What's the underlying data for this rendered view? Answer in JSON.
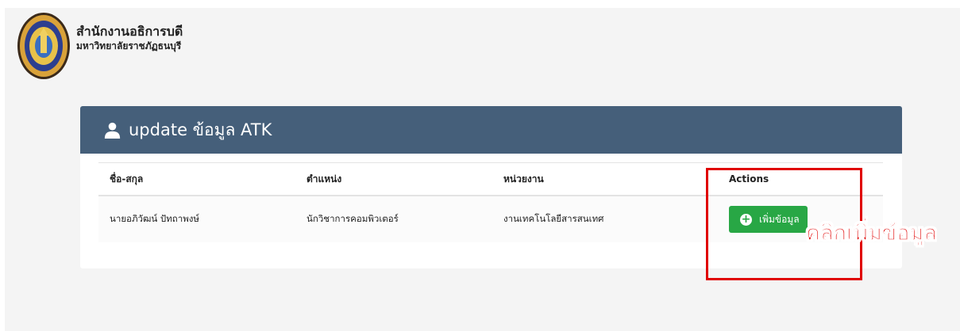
{
  "brand": {
    "title": "สำนักงานอธิการบดี",
    "subtitle": "มหาวิทยาลัยราชภัฏธนบุรี",
    "logo_icon": "university-seal-icon"
  },
  "card": {
    "title": "update ข้อมูล ATK",
    "header_icon": "user-icon",
    "header_color": "#455f7a"
  },
  "table": {
    "columns": [
      "ชื่อ-สกุล",
      "ตำแหน่ง",
      "หน่วยงาน",
      "Actions"
    ],
    "rows": [
      {
        "name": "นายอภิวัฒน์ ปัทถาพงษ์",
        "position": "นักวิชาการคอมพิวเตอร์",
        "department": "งานเทคโนโลยีสารสนเทศ",
        "action_label": "เพิ่มข้อมูล"
      }
    ]
  },
  "annotation": {
    "text": "คลิกเพิ่มข้อมูล",
    "color": "#e00000"
  },
  "colors": {
    "button": "#28a745",
    "page_bg": "#f4f4f4"
  }
}
